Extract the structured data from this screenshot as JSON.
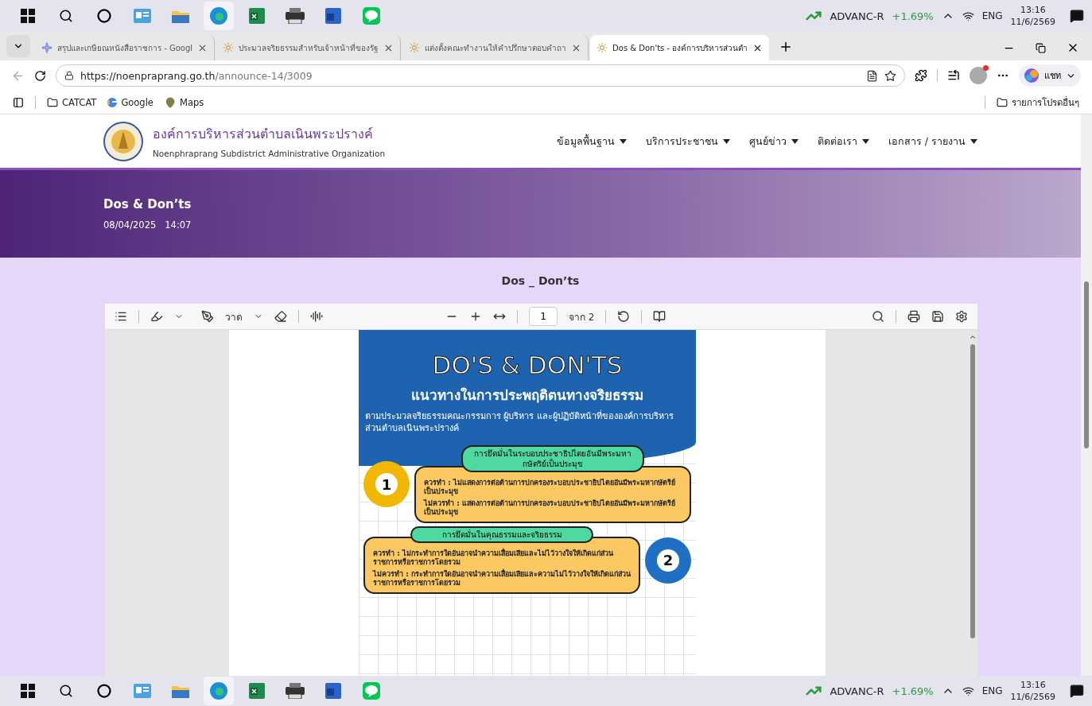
{
  "taskbar_top": {
    "ticker": "ADVANC-R",
    "change": "+1.69%",
    "language": "ENG",
    "time": "13:16",
    "date": "11/6/2569"
  },
  "browser": {
    "tabs": [
      {
        "title": "สรุปและเกษียณหนังสือราชการ - Googl",
        "kind": "sparkle",
        "selected": false
      },
      {
        "title": "ประมวลจริยธรรมสำหรับเจ้าหน้าที่ของรัฐ",
        "kind": "seal",
        "selected": false
      },
      {
        "title": "แต่งตั้งคณะทำงานให้คำปรึกษาตอบคำถา",
        "kind": "seal",
        "selected": false
      },
      {
        "title": "Dos & Don'ts - องค์การบริหารส่วนตำ",
        "kind": "seal",
        "selected": true
      }
    ],
    "url_host": "https://noenpraprang.go.th",
    "url_path": "/announce-14/3009",
    "chat_label": "แชท",
    "bookmarks": [
      {
        "label": "CATCAT",
        "kind": "folder"
      },
      {
        "label": "Google",
        "kind": "google"
      },
      {
        "label": "Maps",
        "kind": "maps"
      }
    ],
    "other_favorites": "รายการโปรดอื่นๆ"
  },
  "site": {
    "org_name": "องค์การบริหารส่วนตำบลเนินพระปรางค์",
    "org_name_en": "Noenphraprang Subdistrict Administrative Organization",
    "nav": [
      "ข้อมูลพื้นฐาน",
      "บริการประชาชน",
      "ศูนย์ข่าว",
      "ติดต่อเรา",
      "เอกสาร / รายงาน"
    ],
    "post_title": "Dos & Don’ts",
    "post_date": "08/04/2025",
    "post_time": "14:07",
    "document_title": "Dos _ Don’ts"
  },
  "pdf_toolbar": {
    "draw_label": "วาด",
    "page": "1",
    "page_total": "จาก 2"
  },
  "pdf_page": {
    "heading": "DO'S & DON'TS",
    "subtitle": "แนวทางในการประพฤติตนทางจริยธรรม",
    "description": "ตามประมวลจริยธรรมคณะกรรมการ ผู้บริหาร และผู้ปฏิบัติหน้าที่ขององค์การบริหารส่วนตำบลเนินพระปรางค์",
    "sections": [
      {
        "number": "1",
        "title": "การยึดมั่นในระบอบประชาธิปไตยอันมีพระมหากษัตริย์เป็นประมุข",
        "do": "ควรทำ : ไม่แสดงการต่อต้านการปกครองระบอบประชาธิปไตยอันมีพระมหากษัตริย์เป็นประมุข",
        "dont": "ไม่ควรทำ : แสดงการต่อต้านการปกครองระบอบประชาธิปไตยอันมีพระมหากษัตริย์เป็นประมุข",
        "color": "#f2b705"
      },
      {
        "number": "2",
        "title": "การยึดมั่นในคุณธรรมและจริยธรรม",
        "do": "ควรทำ : ไม่กระทำการใดอันอาจนำความเสื่อมเสียและไม่ไว้วางใจให้เกิดแก่ส่วนราชการหรือราชการโดยรวม",
        "dont": "ไม่ควรทำ : กระทำการใดอันอาจนำความเสื่อมเสียและความไม่ไว้วางใจให้เกิดแก่ส่วนราชการหรือราชการโดยรวม",
        "color": "#1f6fc4"
      }
    ]
  },
  "taskbar_bottom": {
    "ticker": "ADVANC-R",
    "change": "+1.69%",
    "language": "ENG",
    "time": "13:16",
    "date": "11/6/2569"
  }
}
